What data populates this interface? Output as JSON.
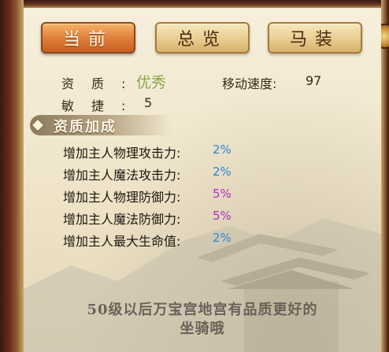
{
  "tabs": [
    {
      "label": "当前",
      "active": true
    },
    {
      "label": "总览",
      "active": false
    },
    {
      "label": "马装",
      "active": false
    }
  ],
  "info": {
    "quality_label": "资质:",
    "quality_value": "优秀",
    "quality_color": "#8aa64a",
    "speed_label": "移动速度:",
    "speed_value": "97",
    "agility_label": "敏捷:",
    "agility_value": "5"
  },
  "section": {
    "title": "资质加成"
  },
  "bonuses": [
    {
      "name": "增加主人物理攻击力:",
      "value": "2%",
      "color": "#2f86d8"
    },
    {
      "name": "增加主人魔法攻击力:",
      "value": "2%",
      "color": "#2f86d8"
    },
    {
      "name": "增加主人物理防御力:",
      "value": "5%",
      "color": "#b02ec6"
    },
    {
      "name": "增加主人魔法防御力:",
      "value": "5%",
      "color": "#b02ec6"
    },
    {
      "name": "增加主人最大生命值:",
      "value": "2%",
      "color": "#2f86d8"
    }
  ],
  "footer": {
    "line1": "50级以后万宝宫地宫有品质更好的",
    "line2": "坐骑哦"
  }
}
